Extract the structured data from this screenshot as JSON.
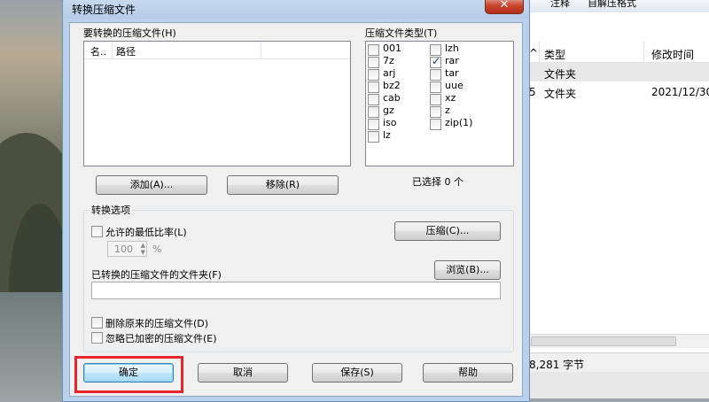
{
  "background_window": {
    "toolbar_items": [
      "注释",
      "自解压格式"
    ],
    "columns": [
      "^",
      "类型",
      "修改时间"
    ],
    "rows": [
      {
        "type": "文件夹",
        "modified": ""
      },
      {
        "prefix": "5",
        "type": "文件夹",
        "modified": "2021/12/30"
      }
    ],
    "status_text": "8,281 字节"
  },
  "dialog": {
    "title": "转换压缩文件",
    "close_label": "✕",
    "files_group_label": "要转换的压缩文件(H)",
    "file_list_columns": [
      "名..",
      "路径"
    ],
    "types_group_label": "压缩文件类型(T)",
    "archive_types_left": [
      {
        "label": "001",
        "checked": false
      },
      {
        "label": "7z",
        "checked": false
      },
      {
        "label": "arj",
        "checked": false
      },
      {
        "label": "bz2",
        "checked": false
      },
      {
        "label": "cab",
        "checked": false
      },
      {
        "label": "gz",
        "checked": false
      },
      {
        "label": "iso",
        "checked": false
      },
      {
        "label": "lz",
        "checked": false
      }
    ],
    "archive_types_right": [
      {
        "label": "lzh",
        "checked": false
      },
      {
        "label": "rar",
        "checked": true
      },
      {
        "label": "tar",
        "checked": false
      },
      {
        "label": "uue",
        "checked": false
      },
      {
        "label": "xz",
        "checked": false
      },
      {
        "label": "z",
        "checked": false
      },
      {
        "label": "zip(1)",
        "checked": false
      }
    ],
    "selected_count_text": "已选择 0 个",
    "add_button": "添加(A)...",
    "remove_button": "移除(R)",
    "options_group_label": "转换选项",
    "min_ratio_label": "允许的最低比率(L)",
    "min_ratio_value": "100",
    "min_ratio_unit": "%",
    "compress_button": "压缩(C)...",
    "dest_folder_label": "已转换的压缩文件的文件夹(F)",
    "dest_folder_value": "",
    "browse_button": "浏览(B)...",
    "delete_original_label": "删除原来的压缩文件(D)",
    "ignore_encrypted_label": "忽略已加密的压缩文件(E)",
    "ok_button": "确定",
    "cancel_button": "取消",
    "save_button": "保存(S)",
    "help_button": "帮助"
  },
  "colors": {
    "highlight": "#e8242d",
    "dialog_frame": "#b9d1ea",
    "close_button": "#c9452f",
    "checkmark": "#223a8f"
  }
}
